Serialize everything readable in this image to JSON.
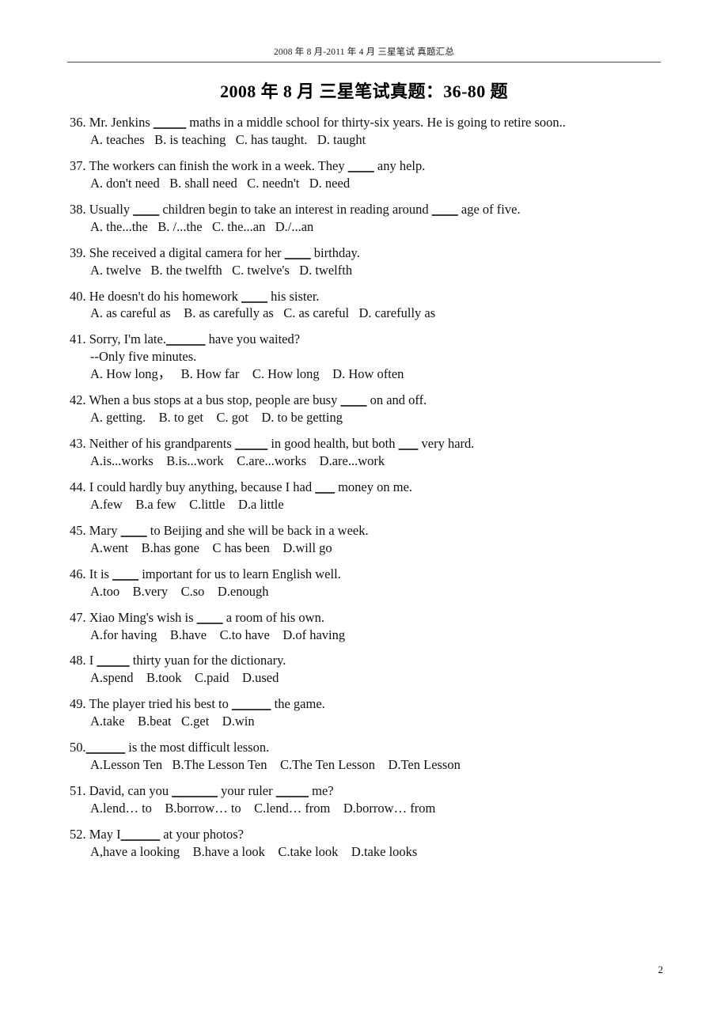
{
  "header": {
    "running_head": "2008 年 8 月-2011 年 4 月  三星笔试 真题汇总"
  },
  "title": "2008 年 8 月  三星笔试真题：36-80 题",
  "footer": {
    "page_number": "2"
  },
  "questions": [
    {
      "stem_pre": "36. Mr. Jenkins ",
      "blank1": "_____",
      "stem_post": " maths in a middle school for thirty-six years. He is going to retire soon..",
      "sub": "",
      "options": "A. teaches   B. is teaching   C. has taught.   D. taught"
    },
    {
      "stem_pre": "37. The workers can finish the work in a week. They ",
      "blank1": "____",
      "stem_post": " any help.",
      "sub": "",
      "options": "A. don't need   B. shall need   C. needn't   D. need"
    },
    {
      "stem_pre": "38. Usually ",
      "blank1": "____",
      "stem_post": " children begin to take an interest in reading around ",
      "blank2": "____",
      "stem_post2": " age of five.",
      "sub": "",
      "options": "A. the...the   B. /...the   C. the...an   D./...an"
    },
    {
      "stem_pre": "39. She received a digital camera for her ",
      "blank1": "____",
      "stem_post": " birthday.",
      "sub": "",
      "options": "A. twelve   B. the twelfth   C. twelve's   D. twelfth"
    },
    {
      "stem_pre": "40. He doesn't do his homework ",
      "blank1": "____",
      "stem_post": " his sister.",
      "sub": "",
      "options": "A. as careful as    B. as carefully as   C. as careful   D. carefully as"
    },
    {
      "stem_pre": "41. Sorry, I'm late.",
      "blank1": "______",
      "stem_post": " have you waited?",
      "sub": "--Only five minutes.",
      "options": "A. How long，   B. How far    C. How long    D. How often"
    },
    {
      "stem_pre": "42. When a bus stops at a bus stop, people are busy ",
      "blank1": "____",
      "stem_post": " on and off.",
      "sub": "",
      "options": "A. getting.    B. to get    C. got    D. to be getting"
    },
    {
      "stem_pre": "43. Neither of his grandparents ",
      "blank1": "_____",
      "stem_post": " in good health, but both ",
      "blank2": "___",
      "stem_post2": " very hard.",
      "sub": "",
      "options": "A.is...works    B.is...work    C.are...works    D.are...work"
    },
    {
      "stem_pre": "44. I could hardly buy anything, because I had ",
      "blank1": "___",
      "stem_post": " money on me.",
      "sub": "",
      "options": "A.few    B.a few    C.little    D.a little"
    },
    {
      "stem_pre": "45. Mary ",
      "blank1": "____",
      "stem_post": " to Beijing and she will be back in a week.",
      "sub": "",
      "options": "A.went    B.has gone    C has been    D.will go"
    },
    {
      "stem_pre": "46. It is ",
      "blank1": "____",
      "stem_post": " important for us to learn English well.",
      "sub": "",
      "options": "A.too    B.very    C.so    D.enough"
    },
    {
      "stem_pre": "47. Xiao Ming's wish is ",
      "blank1": "____",
      "stem_post": " a room of his own.",
      "sub": "",
      "options": "A.for having    B.have    C.to have    D.of having"
    },
    {
      "stem_pre": "48. I ",
      "blank1": "_____",
      "stem_post": " thirty yuan for the dictionary.",
      "sub": "",
      "options": "A.spend    B.took    C.paid    D.used"
    },
    {
      "stem_pre": "49. The player tried his best to ",
      "blank1": "______",
      "stem_post": " the game.",
      "sub": "",
      "options": "A.take    B.beat   C.get    D.win"
    },
    {
      "stem_pre": "50.",
      "blank1": "______",
      "stem_post": " is the most difficult lesson.",
      "sub": "",
      "options": "A.Lesson Ten   B.The Lesson Ten    C.The Ten Lesson    D.Ten Lesson"
    },
    {
      "stem_pre": "51. David, can you ",
      "blank1": "_______",
      "stem_post": " your ruler ",
      "blank2": "_____",
      "stem_post2": " me?",
      "sub": "",
      "options": "A.lend… to    B.borrow… to    C.lend… from    D.borrow… from"
    },
    {
      "stem_pre": "52. May I",
      "blank1": "______",
      "stem_post": " at your photos?",
      "sub": "",
      "options": "A,have a looking    B.have a look    C.take look    D.take looks"
    }
  ]
}
